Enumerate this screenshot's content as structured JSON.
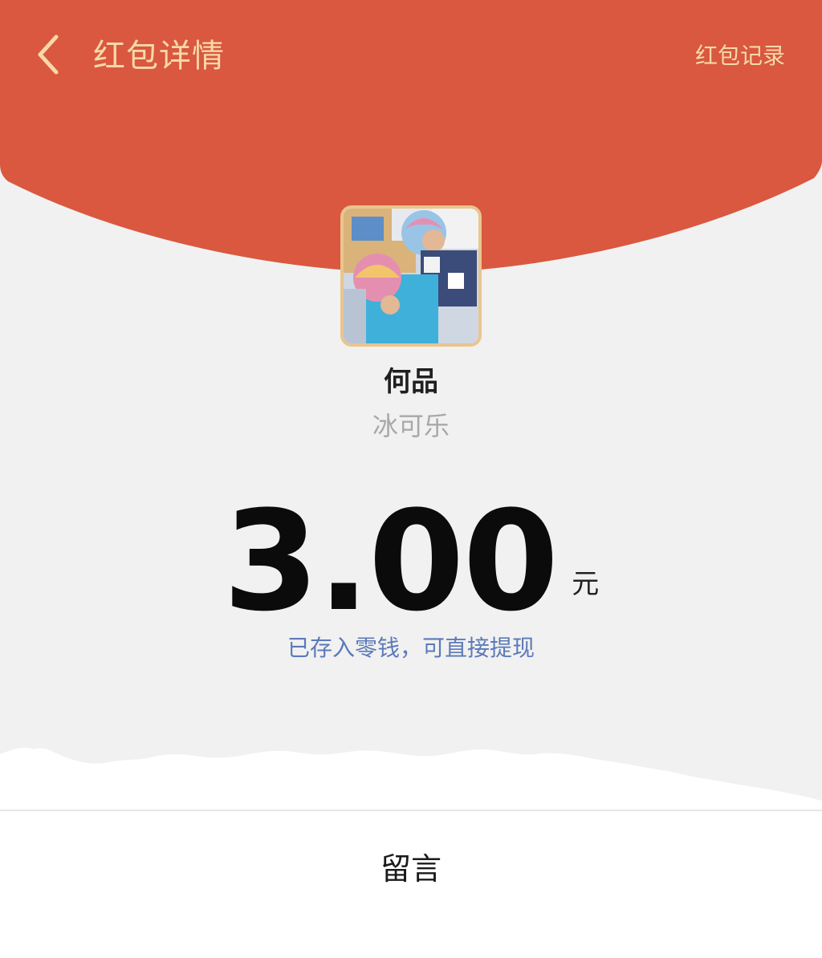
{
  "colors": {
    "header_red": "#d9583f",
    "header_text": "#f7d9a8",
    "background": "#f1f1f1",
    "amount": "#0b0b0b",
    "link_blue": "#5b7ab8",
    "avatar_border": "#e9c58e"
  },
  "header": {
    "back_icon": "chevron-left-icon",
    "title": "红包详情",
    "record_link": "红包记录"
  },
  "sender": {
    "avatar": "avatar-photo",
    "name": "何品",
    "greeting": "冰可乐"
  },
  "amount": {
    "value": "3.00",
    "unit": "元",
    "note": "已存入零钱，可直接提现"
  },
  "footer": {
    "message_button": "留言"
  }
}
